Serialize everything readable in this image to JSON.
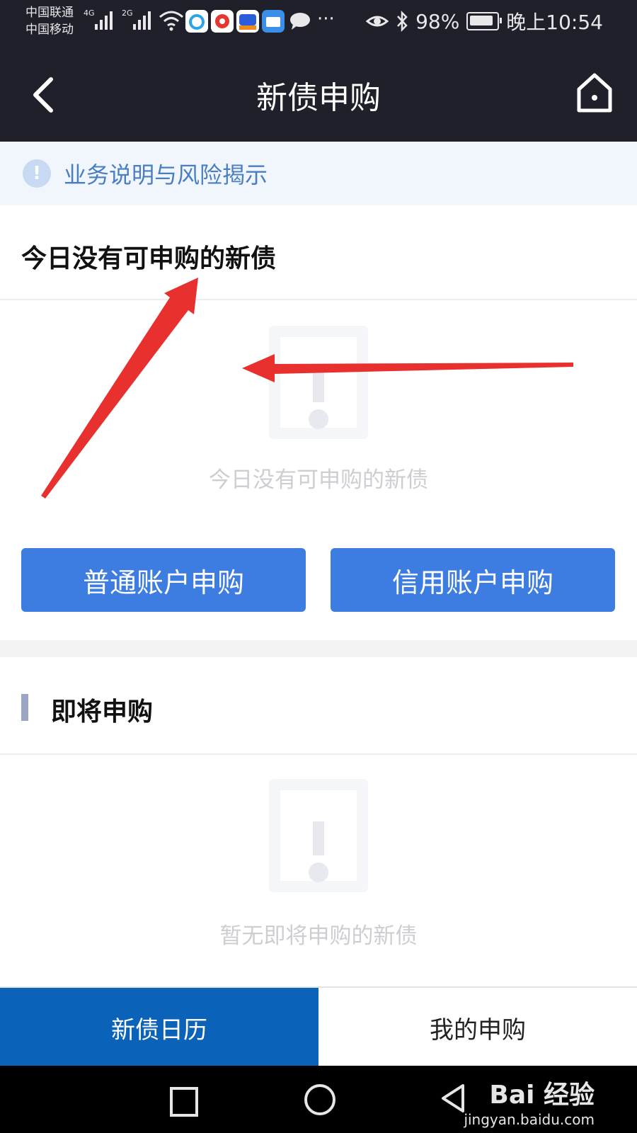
{
  "status_bar": {
    "carrier_1": "中国联通",
    "carrier_2": "中国移动",
    "network_1": "4G",
    "network_2": "2G",
    "more": "···",
    "battery_percent": "98%",
    "time": "晚上10:54",
    "icons": [
      "signal-bars-icon",
      "wifi-icon",
      "app-notification-icon",
      "weibo-icon",
      "baidu-icon",
      "wallet-icon",
      "chat-icon",
      "eye-icon",
      "bluetooth-icon",
      "battery-icon"
    ]
  },
  "header": {
    "title": "新债申购",
    "back_icon": "back-chevron-icon",
    "home_icon": "home-icon"
  },
  "notice": {
    "icon": "info-icon",
    "icon_glyph": "!",
    "text": "业务说明与风险揭示"
  },
  "today": {
    "heading": "今日没有可申购的新债",
    "empty_text": "今日没有可申购的新债"
  },
  "actions": {
    "normal_account": "普通账户申购",
    "credit_account": "信用账户申购"
  },
  "upcoming": {
    "heading": "即将申购",
    "empty_text": "暂无即将申购的新债"
  },
  "tabs": [
    {
      "label": "新债日历",
      "active": true
    },
    {
      "label": "我的申购",
      "active": false
    }
  ],
  "nav_bar": {
    "icons": [
      "recent-apps-icon",
      "home-circle-icon",
      "back-triangle-icon"
    ]
  },
  "watermark": {
    "brand": "Bai  经验",
    "url": "jingyan.baidu.com"
  },
  "colors": {
    "header_bg": "#1f2029",
    "accent_blue": "#3d7ce0",
    "tab_active": "#0a63b8",
    "notice_text": "#4a7ec2",
    "annotation_red": "#e8312f"
  }
}
